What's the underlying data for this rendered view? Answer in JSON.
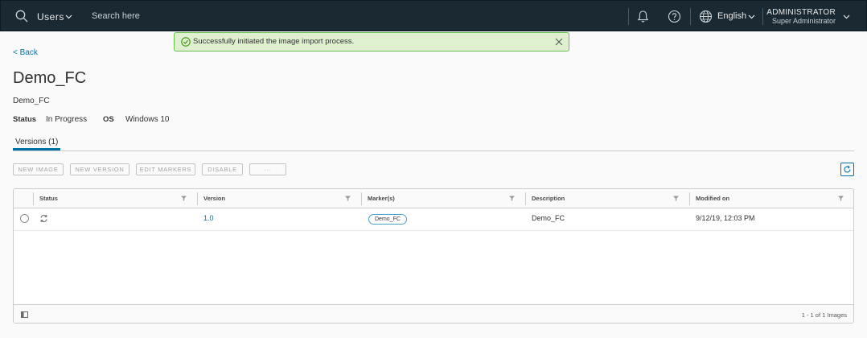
{
  "header": {
    "context_label": "Users",
    "search_placeholder": "Search here",
    "language": "English",
    "user_name": "ADMINISTRATOR",
    "user_role": "Super Administrator"
  },
  "toast": {
    "message": "Successfully initiated the image import process.",
    "type": "success"
  },
  "page": {
    "back_label": "< Back",
    "title": "Demo_FC",
    "subtitle": "Demo_FC",
    "status_label": "Status",
    "status_value": "In Progress",
    "os_label": "OS",
    "os_value": "Windows 10"
  },
  "tabs": [
    {
      "label": "Versions (1)",
      "active": true
    }
  ],
  "toolbar": {
    "buttons": [
      "NEW IMAGE",
      "NEW VERSION",
      "EDIT MARKERS",
      "DISABLE",
      "···"
    ]
  },
  "grid": {
    "columns": [
      "Status",
      "Version",
      "Marker(s)",
      "Description",
      "Modified on"
    ],
    "rows": [
      {
        "status_icon": "sync-icon",
        "version": "1.0",
        "marker": "Demo_FC",
        "description": "Demo_FC",
        "modified_on": "9/12/19, 12:03 PM"
      }
    ],
    "pagination": "1 - 1 of 1 Images"
  },
  "colors": {
    "header_bg": "#1b2a32",
    "accent": "#0072a3",
    "success_bg": "#dff0d0",
    "success_border": "#6abf4b"
  }
}
